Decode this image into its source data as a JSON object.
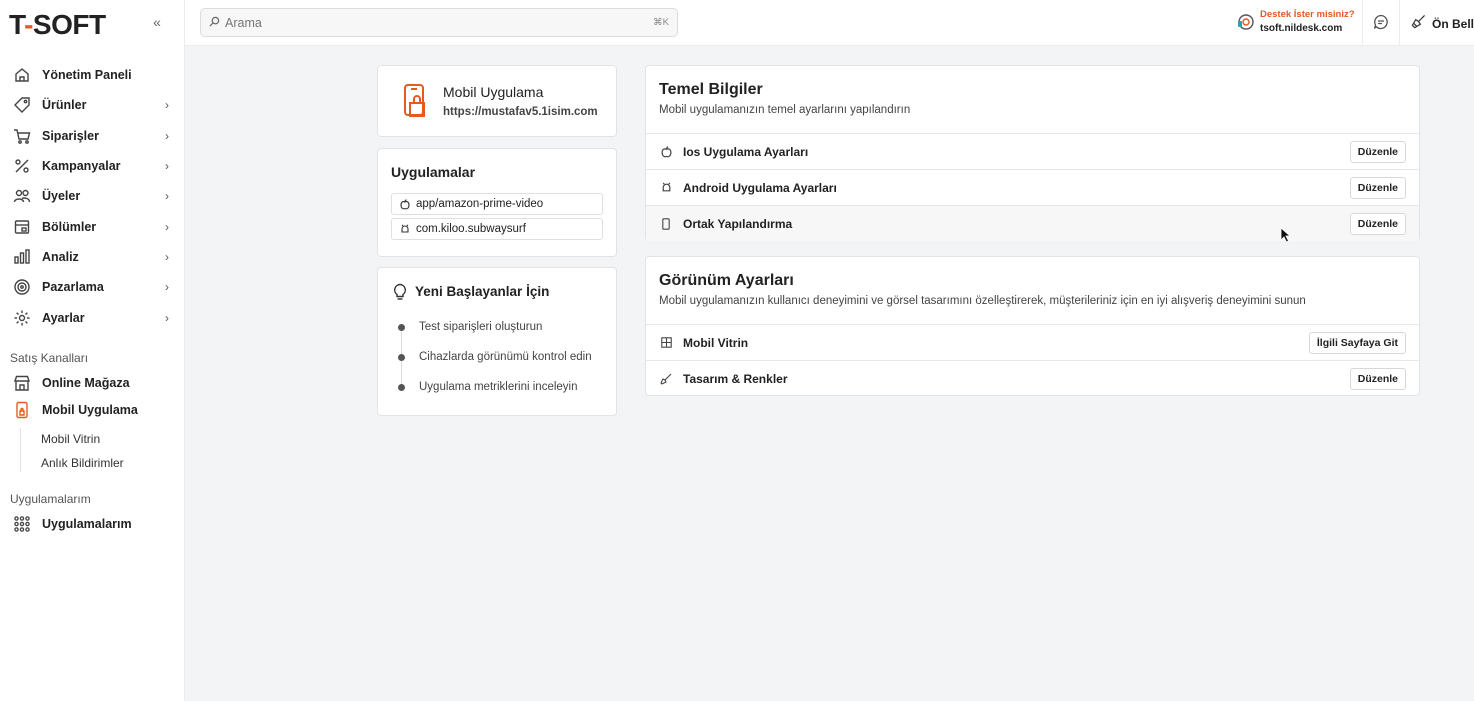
{
  "brand": {
    "logo_left": "T",
    "logo_dash": "-",
    "logo_right": "SOFT",
    "accent": "#e65a1f"
  },
  "sidebar": {
    "nav": [
      {
        "label": "Yönetim Paneli",
        "icon": "home-icon",
        "chevron": false
      },
      {
        "label": "Ürünler",
        "icon": "tag-icon",
        "chevron": true
      },
      {
        "label": "Siparişler",
        "icon": "cart-icon",
        "chevron": true
      },
      {
        "label": "Kampanyalar",
        "icon": "discount-icon",
        "chevron": true
      },
      {
        "label": "Üyeler",
        "icon": "users-icon",
        "chevron": true
      },
      {
        "label": "Bölümler",
        "icon": "sections-icon",
        "chevron": true
      },
      {
        "label": "Analiz",
        "icon": "analytics-icon",
        "chevron": true
      },
      {
        "label": "Pazarlama",
        "icon": "target-icon",
        "chevron": true
      },
      {
        "label": "Ayarlar",
        "icon": "gear-icon",
        "chevron": true
      }
    ],
    "channels_label": "Satış Kanalları",
    "channels": [
      {
        "label": "Online Mağaza",
        "icon": "store-icon"
      },
      {
        "label": "Mobil Uygulama",
        "icon": "mobile-app-icon"
      }
    ],
    "sub_items": [
      "Mobil Vitrin",
      "Anlık Bildirimler"
    ],
    "apps_label": "Uygulamalarım",
    "apps_item": {
      "label": "Uygulamalarım",
      "icon": "apps-grid-icon"
    }
  },
  "header": {
    "search_placeholder": "Arama",
    "search_shortcut": "⌘K",
    "support_title": "Destek İster misiniz?",
    "support_domain": "tsoft.nildesk.com",
    "cache_label": "Ön Belle"
  },
  "app_card": {
    "name": "Mobil Uygulama",
    "url": "https://mustafav5.1isim.com"
  },
  "apps_card": {
    "title": "Uygulamalar",
    "items": [
      {
        "label": "app/amazon-prime-video",
        "icon": "apple-icon"
      },
      {
        "label": "com.kiloo.subwaysurf",
        "icon": "android-icon"
      }
    ]
  },
  "start_card": {
    "title": "Yeni Başlayanlar İçin",
    "steps": [
      "Test siparişleri oluşturun",
      "Cihazlarda görünümü kontrol edin",
      "Uygulama metriklerini inceleyin"
    ]
  },
  "basic_card": {
    "title": "Temel Bilgiler",
    "subtitle": "Mobil uygulamanızın temel ayarlarını yapılandırın",
    "rows": [
      {
        "label": "Ios Uygulama Ayarları",
        "icon": "apple-icon",
        "button": "Düzenle"
      },
      {
        "label": "Android Uygulama Ayarları",
        "icon": "android-icon",
        "button": "Düzenle"
      },
      {
        "label": "Ortak Yapılandırma",
        "icon": "phone-icon",
        "button": "Düzenle"
      }
    ]
  },
  "view_card": {
    "title": "Görünüm Ayarları",
    "subtitle": "Mobil uygulamanızın kullanıcı deneyimini ve görsel tasarımını özelleştirerek, müşterileriniz için en iyi alışveriş deneyimini sunun",
    "rows": [
      {
        "label": "Mobil Vitrin",
        "icon": "grid-icon",
        "button": "İlgili Sayfaya Git"
      },
      {
        "label": "Tasarım & Renkler",
        "icon": "brush-icon",
        "button": "Düzenle"
      }
    ]
  }
}
